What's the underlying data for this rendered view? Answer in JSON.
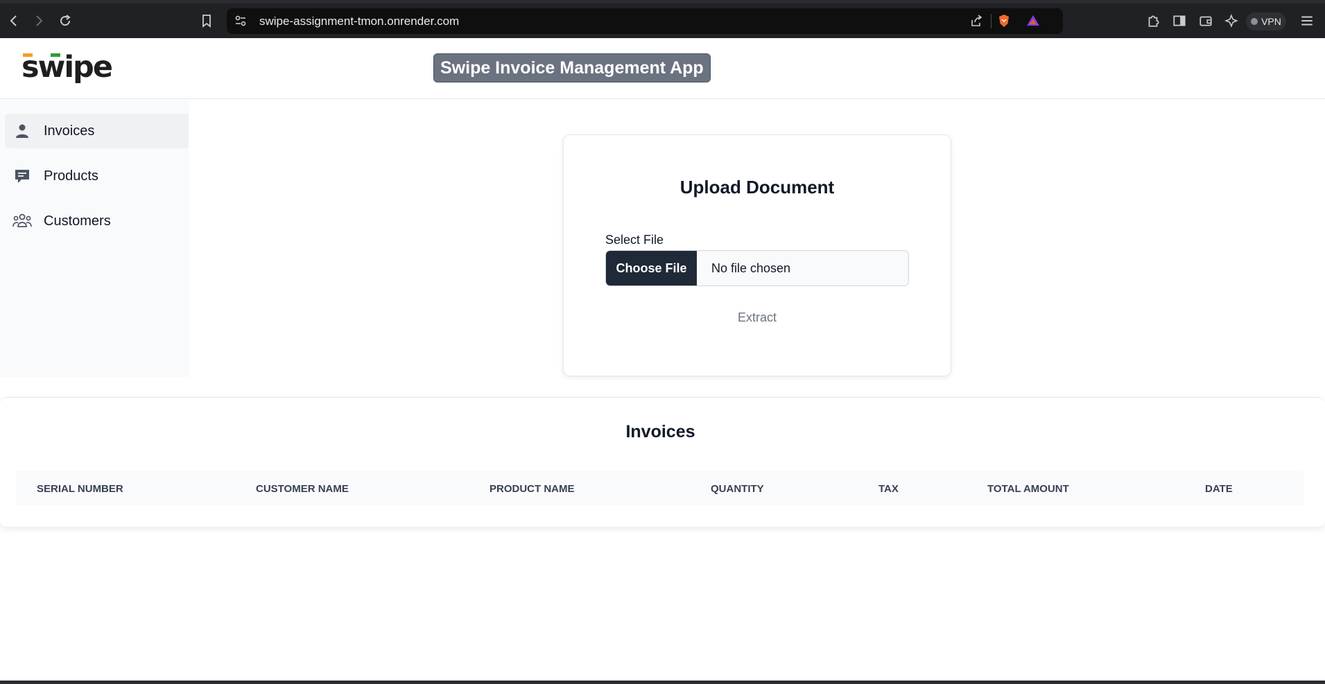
{
  "browser": {
    "url": "swipe-assignment-tmon.onrender.com",
    "vpn_label": "VPN"
  },
  "header": {
    "logo_text": "swipe",
    "title": "Swipe Invoice Management App"
  },
  "sidebar": {
    "items": [
      {
        "label": "Invoices",
        "icon": "person-icon",
        "active": true
      },
      {
        "label": "Products",
        "icon": "message-icon",
        "active": false
      },
      {
        "label": "Customers",
        "icon": "group-icon",
        "active": false
      }
    ]
  },
  "upload": {
    "title": "Upload Document",
    "select_label": "Select File",
    "choose_button": "Choose File",
    "file_status": "No file chosen",
    "extract_button": "Extract"
  },
  "invoices": {
    "title": "Invoices",
    "columns": [
      "SERIAL NUMBER",
      "CUSTOMER NAME",
      "PRODUCT NAME",
      "QUANTITY",
      "TAX",
      "TOTAL AMOUNT",
      "DATE"
    ],
    "rows": []
  },
  "colors": {
    "choose_button_bg": "#1f2937",
    "title_badge_bg": "#6b7280",
    "logo_orange": "#f39c28",
    "logo_green": "#2e9c3a"
  }
}
